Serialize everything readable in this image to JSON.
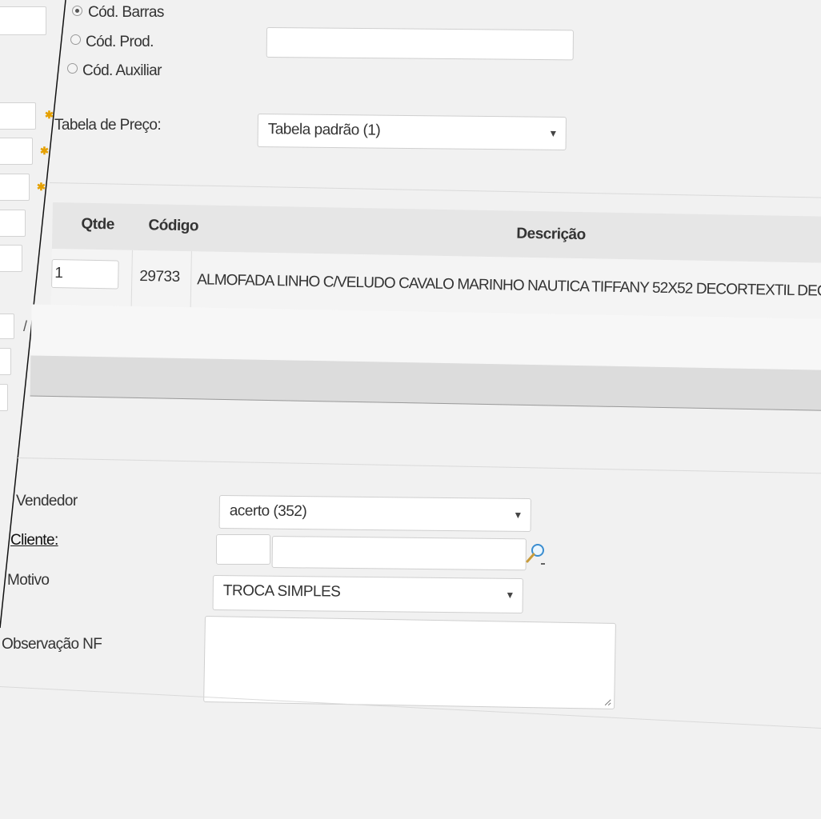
{
  "search": {
    "options": [
      {
        "label": "Cód. Barras",
        "checked": true
      },
      {
        "label": "Cód. Prod.",
        "checked": false
      },
      {
        "label": "Cód. Auxiliar",
        "checked": false
      }
    ],
    "input_value": ""
  },
  "price_table": {
    "label": "Tabela de Preço:",
    "value": "Tabela padrão (1)"
  },
  "items_table": {
    "headers": {
      "qty": "Qtde",
      "code": "Código",
      "description": "Descrição"
    },
    "rows": [
      {
        "qty": "1",
        "code": "29733",
        "description": "ALMOFADA LINHO C/VELUDO CAVALO MARINHO NAUTICA TIFFANY 52X52 DECORTEXTIL DECORTEXTIL"
      }
    ]
  },
  "form": {
    "seller_label": "Vendedor",
    "seller_value": "acerto (352)",
    "client_label": "Cliente:",
    "client_code": "",
    "client_name": "",
    "reason_label": "Motivo",
    "reason_value": "TROCA SIMPLES",
    "note_label": "Observação NF",
    "note_value": ""
  },
  "side_fragment": {
    "slash": "/"
  },
  "icons": {
    "caret": "caret-down-icon",
    "search": "magnifier-icon",
    "required": "asterisk-icon"
  },
  "colors": {
    "required": "#e5a000",
    "table_header": "#e6e6e6",
    "footer_bar": "#dcdcdc"
  }
}
